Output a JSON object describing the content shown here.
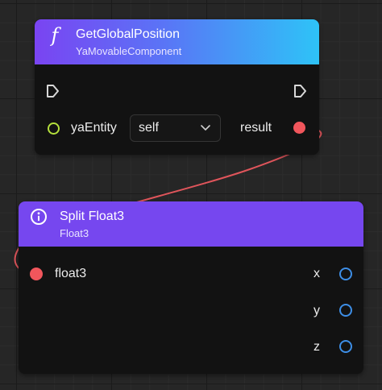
{
  "colors": {
    "canvas_bg": "#262626",
    "node_bg": "#121212",
    "header_gradient_start": "#7a44f2",
    "header_gradient_end": "#2ec3f7",
    "header_purple": "#7647ef",
    "wire": "#e0555b",
    "pin_green": "#b4df3c",
    "pin_red": "#f1565c",
    "pin_blue": "#3d8ee6"
  },
  "nodes": {
    "get_global_position": {
      "icon": "function-icon",
      "icon_glyph": "f",
      "title": "GetGlobalPosition",
      "subtitle": "YaMovableComponent",
      "inputs": [
        {
          "label": "yaEntity",
          "pin_color": "green",
          "value": "self"
        }
      ],
      "outputs": [
        {
          "label": "result",
          "pin_color": "red"
        }
      ]
    },
    "split_float3": {
      "icon": "info-icon",
      "title": "Split Float3",
      "subtitle": "Float3",
      "inputs": [
        {
          "label": "float3",
          "pin_color": "red"
        }
      ],
      "outputs": [
        {
          "label": "x",
          "pin_color": "blue"
        },
        {
          "label": "y",
          "pin_color": "blue"
        },
        {
          "label": "z",
          "pin_color": "blue"
        }
      ]
    }
  }
}
